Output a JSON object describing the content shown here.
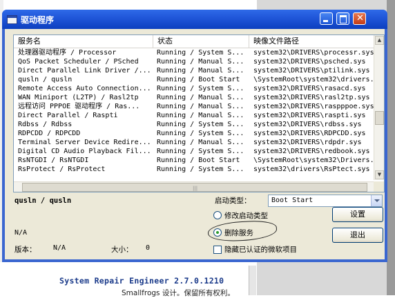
{
  "background": {
    "footer_title": "System Repair Engineer 2.7.0.1210",
    "footer_subtitle": "Smallfrogs 设计。保留所有权利。"
  },
  "window": {
    "title": "驱动程序",
    "controls": {
      "minimize": "minimize-icon",
      "maximize": "maximize-icon",
      "close": "close-icon"
    }
  },
  "table": {
    "columns": [
      "服务名",
      "状态",
      "映像文件路径"
    ],
    "rows": [
      [
        "处理器驱动程序 / Processor",
        "Running / System S...",
        "system32\\DRIVERS\\processr.sys"
      ],
      [
        "QoS Packet Scheduler / PSched",
        "Running / Manual S...",
        "system32\\DRIVERS\\psched.sys"
      ],
      [
        "Direct Parallel Link Driver /...",
        "Running / Manual S...",
        "system32\\DRIVERS\\ptilink.sys"
      ],
      [
        "qusln / qusln",
        "Running / Boot Start",
        "\\SystemRoot\\system32\\drivers..."
      ],
      [
        "Remote Access Auto Connection...",
        "Running / System S...",
        "system32\\DRIVERS\\rasacd.sys"
      ],
      [
        "WAN Miniport (L2TP) / Rasl2tp",
        "Running / Manual S...",
        "system32\\DRIVERS\\rasl2tp.sys"
      ],
      [
        "远程访问 PPPOE 驱动程序 / Ras...",
        "Running / Manual S...",
        "system32\\DRIVERS\\raspppoe.sys"
      ],
      [
        "Direct Parallel / Raspti",
        "Running / Manual S...",
        "system32\\DRIVERS\\raspti.sys"
      ],
      [
        "Rdbss / Rdbss",
        "Running / System S...",
        "system32\\DRIVERS\\rdbss.sys"
      ],
      [
        "RDPCDD / RDPCDD",
        "Running / System S...",
        "system32\\DRIVERS\\RDPCDD.sys"
      ],
      [
        "Terminal Server Device Redire...",
        "Running / Manual S...",
        "system32\\DRIVERS\\rdpdr.sys"
      ],
      [
        "Digital CD Audio Playback Fil...",
        "Running / System S...",
        "system32\\DRIVERS\\redbook.sys"
      ],
      [
        "RsNTGDI / RsNTGDI",
        "Running / Boot Start",
        "\\SystemRoot\\system32\\Drivers..."
      ],
      [
        "RsProtect / RsProtect",
        "Running / System S...",
        "system32\\drivers\\RsPtect.sys"
      ]
    ]
  },
  "details": {
    "selected_name": "qusln / qusln",
    "description": "N/A",
    "version_label": "版本：",
    "version_value": "N/A",
    "size_label": "大小：",
    "size_value": "0"
  },
  "options": {
    "start_type_label": "启动类型：",
    "start_type_value": "Boot Start",
    "radio_modify": "修改启动类型",
    "radio_delete": "删除服务",
    "radio_selected": "delete",
    "hide_verified": "隐藏已认证的微软项目",
    "hide_verified_checked": false
  },
  "buttons": {
    "settings": "设置",
    "exit": "退出"
  }
}
